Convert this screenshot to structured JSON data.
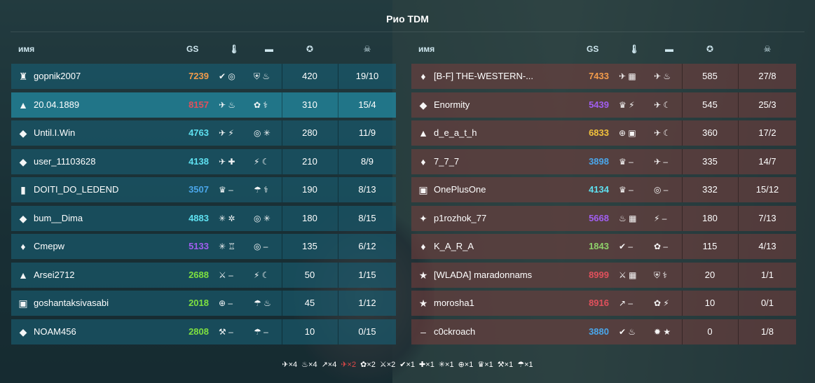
{
  "title": "Рио TDM",
  "headers": {
    "name": "имя",
    "gs": "GS"
  },
  "left_rows": [
    {
      "rank_icon": "♜",
      "name": "gopnik2007",
      "gs": "7239",
      "gs_color": "#f29b4b",
      "t1": "✔ ◎",
      "t2": "⛨ ♨",
      "score": "420",
      "kd": "19/10"
    },
    {
      "rank_icon": "▲",
      "name": "20.04.1889",
      "gs": "8157",
      "gs_color": "#e0505c",
      "t1": "✈ ♨",
      "t2": "✿ ⚕",
      "score": "310",
      "kd": "15/4",
      "me": true
    },
    {
      "rank_icon": "◆",
      "name": "Until.I.Win",
      "gs": "4763",
      "gs_color": "#5ee0f0",
      "t1": "✈ ⚡",
      "t2": "◎ ✳",
      "score": "280",
      "kd": "11/9"
    },
    {
      "rank_icon": "◆",
      "name": "user_11103628",
      "gs": "4138",
      "gs_color": "#5ee0f0",
      "t1": "✈ ✚",
      "t2": "⚡ ☾",
      "score": "210",
      "kd": "8/9"
    },
    {
      "rank_icon": "▮",
      "name": "DOITI_DO_LEDEND",
      "gs": "3507",
      "gs_color": "#4aa6ea",
      "t1": "♛ –",
      "t2": "☂ ⚕",
      "score": "190",
      "kd": "8/13"
    },
    {
      "rank_icon": "◆",
      "name": "bum__Dima",
      "gs": "4883",
      "gs_color": "#5ee0f0",
      "t1": "✳ ✲",
      "t2": "◎ ✳",
      "score": "180",
      "kd": "8/15"
    },
    {
      "rank_icon": "♦",
      "name": "Cmepw",
      "gs": "5133",
      "gs_color": "#a15ef0",
      "t1": "✳ ♖",
      "t2": "◎ –",
      "score": "135",
      "kd": "6/12"
    },
    {
      "rank_icon": "▲",
      "name": "Arsei2712",
      "gs": "2688",
      "gs_color": "#7ee040",
      "t1": "⚔ –",
      "t2": "⚡ ☾",
      "score": "50",
      "kd": "1/15"
    },
    {
      "rank_icon": "▣",
      "name": "goshantaksivasabi",
      "gs": "2018",
      "gs_color": "#7ee040",
      "t1": "⊕ –",
      "t2": "☂ ♨",
      "score": "45",
      "kd": "1/12"
    },
    {
      "rank_icon": "◆",
      "name": "NOAM456",
      "gs": "2808",
      "gs_color": "#7ee040",
      "t1": "⚒ –",
      "t2": "☂ –",
      "score": "10",
      "kd": "0/15"
    }
  ],
  "right_rows": [
    {
      "rank_icon": "♦",
      "name": "[B-F] THE-WESTERN-...",
      "gs": "7433",
      "gs_color": "#f29b4b",
      "t1": "✈ ▦",
      "t2": "✈ ♨",
      "score": "585",
      "kd": "27/8"
    },
    {
      "rank_icon": "◆",
      "name": "Enormity",
      "gs": "5439",
      "gs_color": "#a15ef0",
      "t1": "♛ ⚡",
      "t2": "✈ ☾",
      "score": "545",
      "kd": "25/3"
    },
    {
      "rank_icon": "▲",
      "name": "d_e_a_t_h",
      "gs": "6833",
      "gs_color": "#f2c23c",
      "t1": "⊕ ▣",
      "t2": "✈ ☾",
      "score": "360",
      "kd": "17/2"
    },
    {
      "rank_icon": "♦",
      "name": "7_7_7",
      "gs": "3898",
      "gs_color": "#4aa6ea",
      "t1": "♛ –",
      "t2": "✈ –",
      "score": "335",
      "kd": "14/7"
    },
    {
      "rank_icon": "▣",
      "name": "OnePlusOne",
      "gs": "4134",
      "gs_color": "#5ee0f0",
      "t1": "♛ –",
      "t2": "◎ –",
      "score": "332",
      "kd": "15/12"
    },
    {
      "rank_icon": "✦",
      "name": "p1rozhok_77",
      "gs": "5668",
      "gs_color": "#a15ef0",
      "t1": "♨ ▦",
      "t2": "⚡ –",
      "score": "180",
      "kd": "7/13"
    },
    {
      "rank_icon": "♦",
      "name": "K_A_R_A",
      "gs": "1843",
      "gs_color": "#8ed06a",
      "t1": "✔ –",
      "t2": "✿ –",
      "score": "115",
      "kd": "4/13"
    },
    {
      "rank_icon": "★",
      "name": "[WLADA] maradonnams",
      "gs": "8999",
      "gs_color": "#e0505c",
      "t1": "⚔ ▦",
      "t2": "⛨ ⚕",
      "score": "20",
      "kd": "1/1"
    },
    {
      "rank_icon": "★",
      "name": "morosha1",
      "gs": "8916",
      "gs_color": "#e0505c",
      "t1": "↗ –",
      "t2": "✿ ⚡",
      "score": "10",
      "kd": "0/1"
    },
    {
      "rank_icon": "–",
      "name": "c0ckroach",
      "gs": "3880",
      "gs_color": "#4aa6ea",
      "t1": "✔ ♨",
      "t2": "✹ ★",
      "score": "0",
      "kd": "1/8"
    }
  ],
  "footer_items": [
    {
      "icon": "✈",
      "label": "×4"
    },
    {
      "icon": "♨",
      "label": "×4"
    },
    {
      "icon": "↗",
      "label": "×4"
    },
    {
      "icon": "✈",
      "label": "×2",
      "highlight": true
    },
    {
      "icon": "✿",
      "label": "×2"
    },
    {
      "icon": "⚔",
      "label": "×2"
    },
    {
      "icon": "✔",
      "label": "×1"
    },
    {
      "icon": "✚",
      "label": "×1"
    },
    {
      "icon": "✳",
      "label": "×1"
    },
    {
      "icon": "⊕",
      "label": "×1"
    },
    {
      "icon": "♛",
      "label": "×1"
    },
    {
      "icon": "⚒",
      "label": "×1"
    },
    {
      "icon": "☂",
      "label": "×1"
    }
  ]
}
